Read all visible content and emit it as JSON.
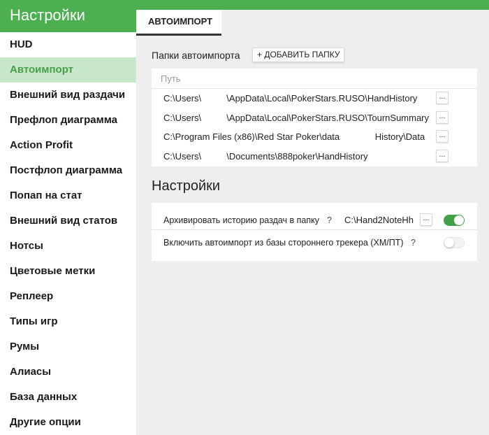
{
  "sidebar": {
    "title": "Настройки",
    "items": [
      {
        "label": "HUD"
      },
      {
        "label": "Автоимпорт",
        "active": true
      },
      {
        "label": "Внешний вид раздачи"
      },
      {
        "label": "Префлоп диаграмма"
      },
      {
        "label": "Action Profit"
      },
      {
        "label": "Постфлоп диаграмма"
      },
      {
        "label": "Попап на стат"
      },
      {
        "label": "Внешний вид статов"
      },
      {
        "label": "Нотсы"
      },
      {
        "label": "Цветовые метки"
      },
      {
        "label": "Реплеер"
      },
      {
        "label": "Типы игр"
      },
      {
        "label": "Румы"
      },
      {
        "label": "Алиасы"
      },
      {
        "label": "База данных"
      },
      {
        "label": "Другие опции"
      }
    ]
  },
  "tabs": [
    {
      "label": "АВТОИМПОРТ"
    }
  ],
  "import_folders": {
    "label": "Папки автоимпорта",
    "add_button": "+ ДОБАВИТЬ ПАПКУ",
    "column_header": "Путь",
    "paths": [
      {
        "value": "C:\\Users\\          \\AppData\\Local\\PokerStars.RUSO\\HandHistory",
        "button": "..."
      },
      {
        "value": "C:\\Users\\          \\AppData\\Local\\PokerStars.RUSO\\TournSummary",
        "button": "..."
      },
      {
        "value": "C:\\Program Files (x86)\\Red Star Poker\\data              History\\Data",
        "button": "..."
      },
      {
        "value": "C:\\Users\\          \\Documents\\888poker\\HandHistory",
        "button": "..."
      }
    ]
  },
  "settings": {
    "title": "Настройки",
    "archive": {
      "label": "Архивировать историю раздач в папку",
      "help": "?",
      "path": "C:\\Hand2NoteHh",
      "button": "...",
      "enabled": true
    },
    "third_party": {
      "label": "Включить автоимпорт из базы стороннего трекера (ХМ/ПТ)",
      "help": "?",
      "enabled": false
    }
  },
  "colors": {
    "accent": "#4caf50",
    "active_bg": "#c8e6c9",
    "toggle_on": "#43a047"
  }
}
